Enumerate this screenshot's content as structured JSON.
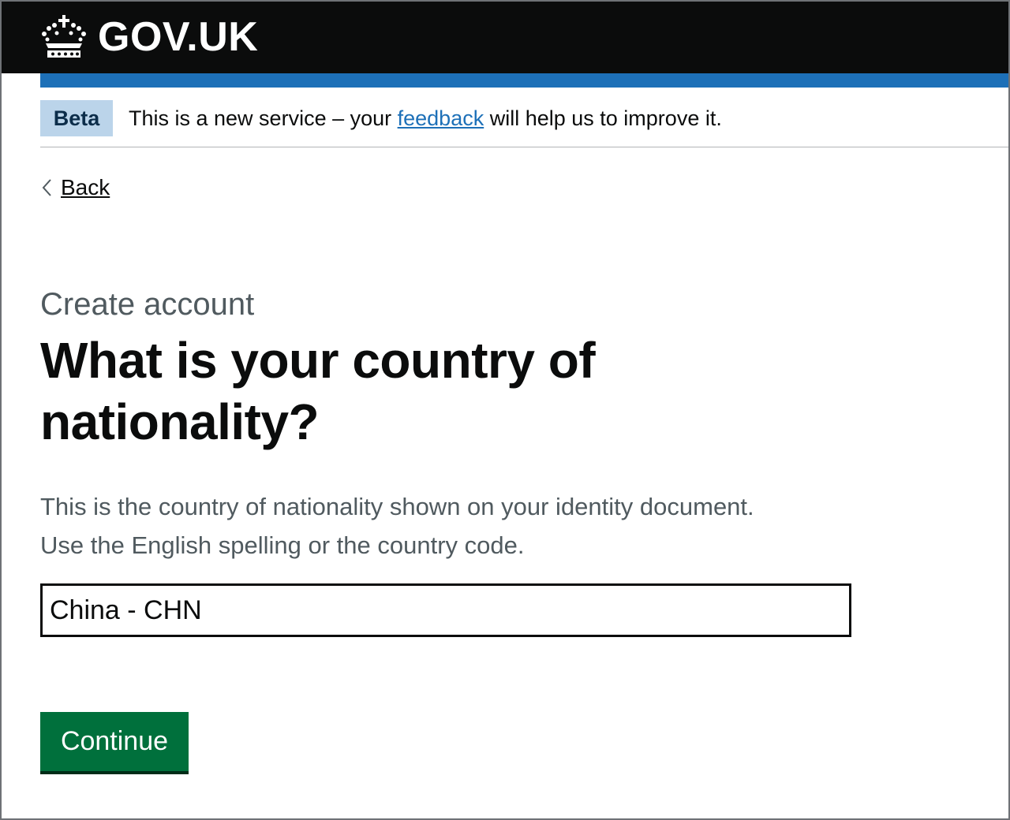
{
  "header": {
    "logo_text": "GOV.UK",
    "logo_icon": "crown-icon"
  },
  "phase_banner": {
    "tag": "Beta",
    "text_before": "This is a new service – your ",
    "link_text": "feedback",
    "text_after": " will help us to improve it."
  },
  "back_link": {
    "label": "Back",
    "icon": "chevron-left-icon"
  },
  "page": {
    "caption": "Create account",
    "heading": "What is your country of nationality?",
    "hint_line1": "This is the country of nationality shown on your identity document.",
    "hint_line2": "Use the English spelling or the country code."
  },
  "nationality_input": {
    "value": "China - CHN"
  },
  "continue_button": {
    "label": "Continue"
  },
  "colors": {
    "header_bg": "#0b0c0c",
    "brand_blue": "#1d70b8",
    "beta_tag_bg": "#bbd4ea",
    "button_green": "#00703c",
    "secondary_text": "#505a5f"
  }
}
